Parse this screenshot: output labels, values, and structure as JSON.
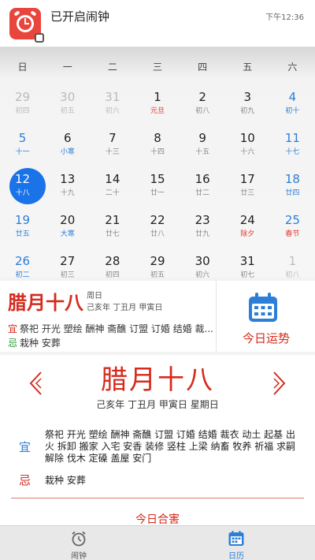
{
  "notification": {
    "title": "已开启闹钟",
    "time": "下午12:36",
    "icon": "alarm-clock-icon"
  },
  "calendar": {
    "weekdays": [
      "日",
      "一",
      "二",
      "三",
      "四",
      "五",
      "六"
    ],
    "rows": [
      [
        {
          "d": "29",
          "l": "初四",
          "k": "dim"
        },
        {
          "d": "30",
          "l": "初五",
          "k": "dim"
        },
        {
          "d": "31",
          "l": "初六",
          "k": "dim"
        },
        {
          "d": "1",
          "l": "元旦",
          "k": "festival"
        },
        {
          "d": "2",
          "l": "初八",
          "k": ""
        },
        {
          "d": "3",
          "l": "初九",
          "k": ""
        },
        {
          "d": "4",
          "l": "初十",
          "k": "weekend"
        }
      ],
      [
        {
          "d": "5",
          "l": "十一",
          "k": "weekend"
        },
        {
          "d": "6",
          "l": "小寒",
          "k": "term"
        },
        {
          "d": "7",
          "l": "十三",
          "k": ""
        },
        {
          "d": "8",
          "l": "十四",
          "k": ""
        },
        {
          "d": "9",
          "l": "十五",
          "k": ""
        },
        {
          "d": "10",
          "l": "十六",
          "k": ""
        },
        {
          "d": "11",
          "l": "十七",
          "k": "weekend"
        }
      ],
      [
        {
          "d": "12",
          "l": "十八",
          "k": "sel"
        },
        {
          "d": "13",
          "l": "十九",
          "k": ""
        },
        {
          "d": "14",
          "l": "二十",
          "k": ""
        },
        {
          "d": "15",
          "l": "廿一",
          "k": ""
        },
        {
          "d": "16",
          "l": "廿二",
          "k": ""
        },
        {
          "d": "17",
          "l": "廿三",
          "k": ""
        },
        {
          "d": "18",
          "l": "廿四",
          "k": "weekend"
        }
      ],
      [
        {
          "d": "19",
          "l": "廿五",
          "k": "weekend"
        },
        {
          "d": "20",
          "l": "大寒",
          "k": "term"
        },
        {
          "d": "21",
          "l": "廿七",
          "k": ""
        },
        {
          "d": "22",
          "l": "廿八",
          "k": ""
        },
        {
          "d": "23",
          "l": "廿九",
          "k": ""
        },
        {
          "d": "24",
          "l": "除夕",
          "k": "festival"
        },
        {
          "d": "25",
          "l": "春节",
          "k": "weekend festival"
        }
      ],
      [
        {
          "d": "26",
          "l": "初二",
          "k": "weekend"
        },
        {
          "d": "27",
          "l": "初三",
          "k": ""
        },
        {
          "d": "28",
          "l": "初四",
          "k": ""
        },
        {
          "d": "29",
          "l": "初五",
          "k": ""
        },
        {
          "d": "30",
          "l": "初六",
          "k": ""
        },
        {
          "d": "31",
          "l": "初七",
          "k": ""
        },
        {
          "d": "1",
          "l": "初八",
          "k": "dim"
        }
      ]
    ]
  },
  "info": {
    "lunar": "腊月十八",
    "weekday": "周日",
    "ganzhi": "己亥年 丁丑月 甲寅日",
    "yi_tag": "宜",
    "yi": "祭祀 开光 塑绘 酬神 斋醮 订盟 订婚 结婚 裁...",
    "ji_tag": "忌",
    "ji": "栽种 安葬",
    "fortune_label": "今日运势",
    "fortune_icon": "calendar-icon"
  },
  "detail": {
    "lunar": "腊月十八",
    "ganzhi": "己亥年 丁丑月 甲寅日 星期日",
    "yi_tag": "宜",
    "yi": "祭祀 开光 塑绘 酬神 斋醮 订盟 订婚 结婚 裁衣 动土 起基 出火 拆卸 搬家 入宅 安香 装修 竖柱 上梁 纳畜 牧养 祈福 求嗣 解除 伐木 定磉 盖屋 安门",
    "ji_tag": "忌",
    "ji": "栽种 安葬",
    "link": "今日合害"
  },
  "tabs": [
    {
      "label": "闹钟",
      "icon": "alarm-clock-icon"
    },
    {
      "label": "日历",
      "icon": "calendar-icon"
    }
  ],
  "colors": {
    "accent_red": "#d52b1e",
    "accent_blue": "#2c7ed6",
    "selected": "#1a73e8"
  }
}
